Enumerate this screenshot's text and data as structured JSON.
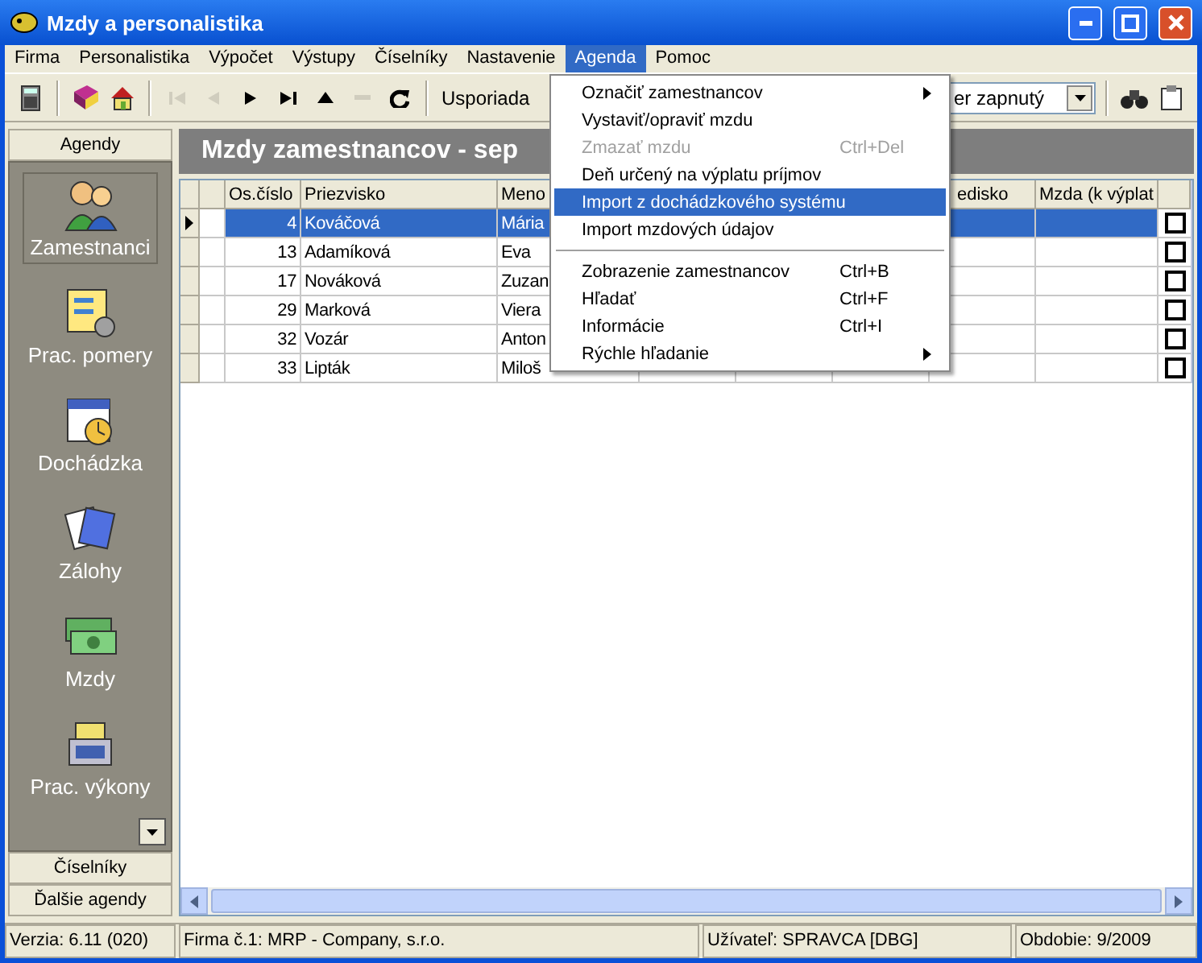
{
  "window": {
    "title": "Mzdy a personalistika"
  },
  "menubar": [
    {
      "label": "Firma",
      "selected": false
    },
    {
      "label": "Personalistika",
      "selected": false
    },
    {
      "label": "Výpočet",
      "selected": false
    },
    {
      "label": "Výstupy",
      "selected": false
    },
    {
      "label": "Číselníky",
      "selected": false
    },
    {
      "label": "Nastavenie",
      "selected": false
    },
    {
      "label": "Agenda",
      "selected": true
    },
    {
      "label": "Pomoc",
      "selected": false
    }
  ],
  "toolbar": {
    "tools": [
      {
        "disabled": false
      },
      {
        "disabled": false
      },
      {
        "disabled": false
      },
      {
        "disabled": true
      },
      {
        "disabled": true
      },
      {
        "disabled": false
      },
      {
        "disabled": false
      },
      {
        "disabled": false
      },
      {
        "disabled": true
      },
      {
        "disabled": false
      }
    ],
    "sort_label": "Usporiada",
    "filter_value": "er zapnutý"
  },
  "sidebar": {
    "header": "Agendy",
    "items": [
      {
        "label": "Zamestnanci",
        "selected": true
      },
      {
        "label": "Prac. pomery",
        "selected": false
      },
      {
        "label": "Dochádzka",
        "selected": false
      },
      {
        "label": "Zálohy",
        "selected": false
      },
      {
        "label": "Mzdy",
        "selected": false
      },
      {
        "label": "Prac. výkony",
        "selected": false
      }
    ],
    "footer": [
      "Číselníky",
      "Ďalšie agendy"
    ]
  },
  "banner": "Mzdy zamestnancov - sep",
  "table": {
    "columns": [
      "Os.číslo",
      "Priezvisko",
      "Meno",
      "",
      "",
      "",
      "edisko",
      "Mzda (k výplat"
    ],
    "rows": [
      {
        "cells": [
          "4",
          "Kováčová",
          "Mária"
        ],
        "selected": true,
        "checked": false
      },
      {
        "cells": [
          "13",
          "Adamíková",
          "Eva"
        ],
        "selected": false,
        "checked": false
      },
      {
        "cells": [
          "17",
          "Nováková",
          "Zuzan"
        ],
        "selected": false,
        "checked": false
      },
      {
        "cells": [
          "29",
          "Marková",
          "Viera"
        ],
        "selected": false,
        "checked": false
      },
      {
        "cells": [
          "32",
          "Vozár",
          "Anton"
        ],
        "selected": false,
        "checked": false
      },
      {
        "cells": [
          "33",
          "Lipták",
          "Miloš"
        ],
        "selected": false,
        "checked": false
      }
    ]
  },
  "menu": [
    {
      "kind": "item",
      "label": "Označiť zamestnancov",
      "submenu": true,
      "disabled": false,
      "selected": false
    },
    {
      "kind": "item",
      "label": "Vystaviť/opraviť mzdu",
      "submenu": false,
      "disabled": false,
      "selected": false
    },
    {
      "kind": "item",
      "label": "Zmazať mzdu",
      "shortcut": "Ctrl+Del",
      "submenu": false,
      "disabled": true,
      "selected": false
    },
    {
      "kind": "item",
      "label": "Deň určený na výplatu príjmov",
      "submenu": false,
      "disabled": false,
      "selected": false
    },
    {
      "kind": "item",
      "label": "Import z dochádzkového systému",
      "submenu": false,
      "disabled": false,
      "selected": true
    },
    {
      "kind": "item",
      "label": "Import mzdových údajov",
      "submenu": false,
      "disabled": false,
      "selected": false
    },
    {
      "kind": "separator"
    },
    {
      "kind": "item",
      "label": "Zobrazenie zamestnancov",
      "shortcut": "Ctrl+B",
      "submenu": false,
      "disabled": false,
      "selected": false
    },
    {
      "kind": "item",
      "label": "Hľadať",
      "shortcut": "Ctrl+F",
      "submenu": false,
      "disabled": false,
      "selected": false
    },
    {
      "kind": "item",
      "label": "Informácie",
      "shortcut": "Ctrl+I",
      "submenu": false,
      "disabled": false,
      "selected": false
    },
    {
      "kind": "item",
      "label": "Rýchle hľadanie",
      "submenu": true,
      "disabled": false,
      "selected": false
    }
  ],
  "status_bar": [
    "Verzia: 6.11 (020)",
    "Firma č.1: MRP -  Company, s.r.o.",
    "Užívateľ: SPRAVCA [DBG]",
    "Obdobie: 9/2009"
  ]
}
